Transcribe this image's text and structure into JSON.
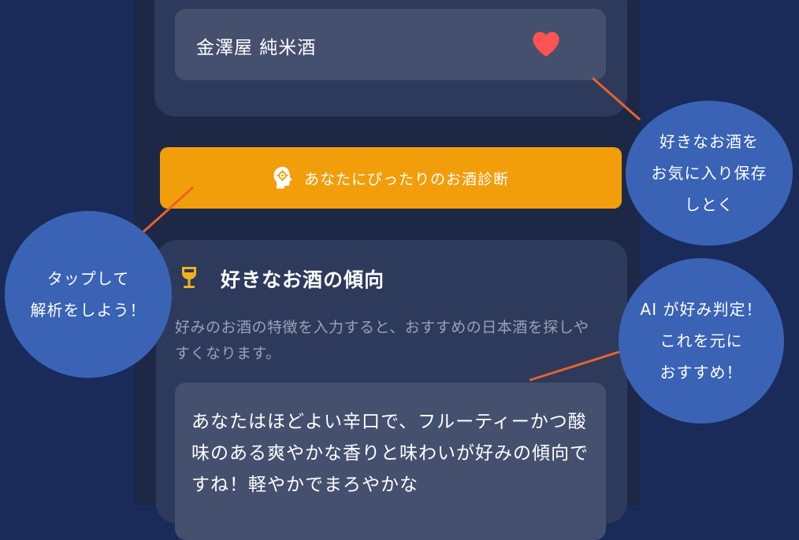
{
  "favorites": {
    "item_name": "金澤屋 純米酒",
    "heart_icon": "heart-icon",
    "heart_color": "#ff5252"
  },
  "diagnosis": {
    "button_label": "あなたにぴったりのお酒診断",
    "icon": "brain-gear-icon",
    "button_color": "#f29e0a"
  },
  "trend": {
    "title": "好きなお酒の傾向",
    "icon": "wine-glass-icon",
    "description": "好みのお酒の特徴を入力すると、おすすめの日本酒を探しやすくなります。",
    "result_text": "あなたはほどよい辛口で、フルーティーかつ酸味のある爽やかな香りと味わいが好みの傾向ですね！軽やかでまろやかな"
  },
  "callouts": {
    "favorite_note": [
      "好きなお酒を",
      "お気に入り保存",
      "しとく"
    ],
    "tap_note": [
      "タップして",
      "解析をしよう！"
    ],
    "ai_note": [
      "AI が好み判定！",
      "これを元に",
      "おすすめ！"
    ]
  },
  "colors": {
    "background": "#1a2b5a",
    "card": "#2e3a5c",
    "accent_line": "#e8622c",
    "callout": "#3a63b6"
  }
}
